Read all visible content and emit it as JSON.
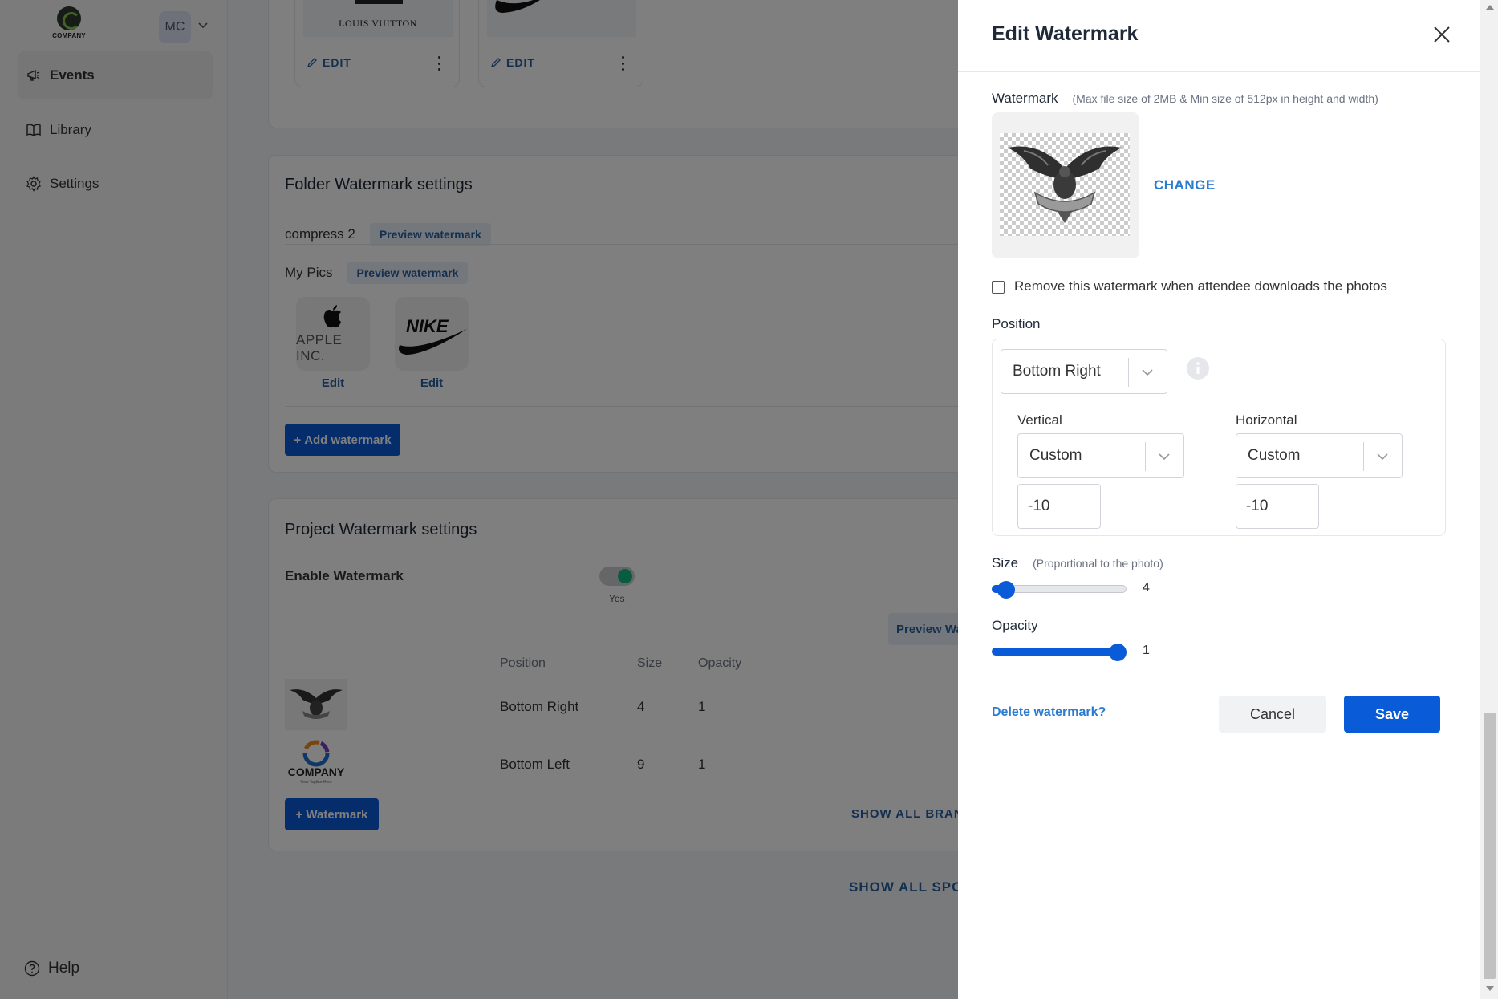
{
  "sidebar": {
    "logo_text": "COMPANY",
    "avatar_initials": "MC",
    "items": [
      {
        "label": "Events",
        "icon": "megaphone-icon"
      },
      {
        "label": "Library",
        "icon": "book-icon"
      },
      {
        "label": "Settings",
        "icon": "gear-icon"
      }
    ],
    "help_label": "Help"
  },
  "brand_tiles": [
    {
      "image_text": "LOUIS VUITTON",
      "edit_label": "EDIT"
    },
    {
      "image_text": "",
      "edit_label": "EDIT"
    }
  ],
  "folder_watermark": {
    "title": "Folder Watermark settings",
    "folders": [
      {
        "name": "compress 2",
        "preview_label": "Preview watermark"
      },
      {
        "name": "My Pics",
        "preview_label": "Preview watermark"
      }
    ],
    "watermarks": [
      {
        "image_text": "APPLE INC.",
        "edit_label": "Edit"
      },
      {
        "image_text": "NIKE",
        "edit_label": "Edit"
      }
    ],
    "add_button": "Add watermark"
  },
  "project_watermark": {
    "title": "Project Watermark settings",
    "enable_label": "Enable Watermark",
    "toggle_state": "Yes",
    "preview_label": "Preview Wa",
    "columns": [
      "Position",
      "Size",
      "Opacity"
    ],
    "rows": [
      {
        "position": "Bottom Right",
        "size": "4",
        "opacity": "1"
      },
      {
        "position": "Bottom Left",
        "size": "9",
        "opacity": "1",
        "image_text": "COMPANY",
        "image_subtext": "Your Tagline Here"
      }
    ],
    "add_button": "Watermark",
    "show_all_branding": "SHOW ALL BRANDI",
    "show_all_sponsors": "SHOW ALL SPON"
  },
  "drawer": {
    "title": "Edit Watermark",
    "watermark_label": "Watermark",
    "watermark_hint": "(Max file size of 2MB & Min size of 512px in height and width)",
    "change_label": "CHANGE",
    "remove_checkbox_label": "Remove this watermark when attendee downloads the photos",
    "remove_checked": false,
    "position_label": "Position",
    "position_value": "Bottom Right",
    "vertical_label": "Vertical",
    "vertical_value": "Custom",
    "vertical_offset": "-10",
    "horizontal_label": "Horizontal",
    "horizontal_value": "Custom",
    "horizontal_offset": "-10",
    "size_label": "Size",
    "size_hint": "(Proportional to the photo)",
    "size_value": "4",
    "size_fraction": 0.05,
    "opacity_label": "Opacity",
    "opacity_value": "1",
    "opacity_fraction": 1.0,
    "delete_label": "Delete watermark?",
    "cancel_label": "Cancel",
    "save_label": "Save"
  },
  "colors": {
    "primary": "#0a5bd8",
    "link": "#2b7bd0",
    "toggle_on": "#10b981"
  }
}
